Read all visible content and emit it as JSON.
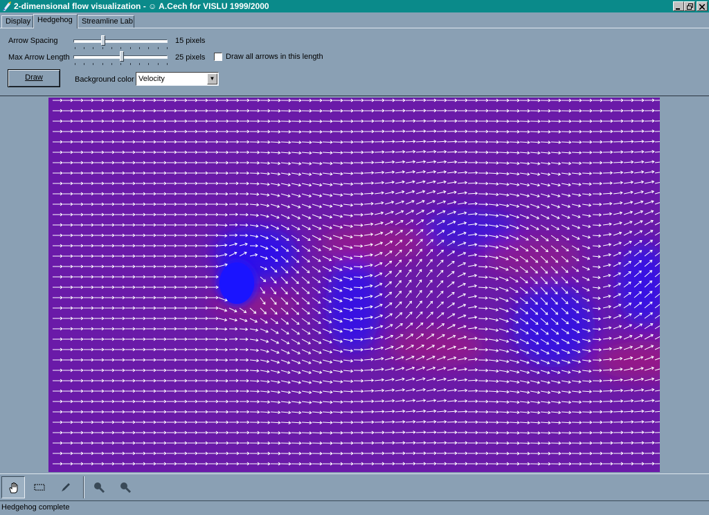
{
  "window": {
    "title": "2-dimensional flow visualization - ☺ A.Cech for VISLU 1999/2000",
    "controls": [
      "minimize",
      "restore",
      "close"
    ]
  },
  "tabs": [
    {
      "label": "Display",
      "active": false
    },
    {
      "label": "Hedgehog",
      "active": true
    },
    {
      "label": "Streamline Lab",
      "active": false
    }
  ],
  "hedgehog": {
    "arrow_spacing_label": "Arrow Spacing",
    "arrow_spacing_value": 15,
    "arrow_spacing_text": "15 pixels",
    "arrow_spacing_fraction": 0.4,
    "max_length_label": "Max Arrow Length",
    "max_length_value": 25,
    "max_length_text": "25 pixels",
    "max_length_fraction": 0.65,
    "draw_all_label": "Draw all arrows in this length",
    "draw_all_checked": false,
    "draw_button": "Draw",
    "bg_color_label": "Background color",
    "bg_color_value": "Velocity"
  },
  "visualization": {
    "base_color": "#6a1aa8",
    "low_velocity_color": "#2a10f0",
    "high_velocity_color": "#c0186a",
    "arrow_color": "#ffffff"
  },
  "toolbar": {
    "tools": [
      "hand-icon",
      "select-rect-icon",
      "pen-icon",
      "zoom-in-icon",
      "zoom-out-icon"
    ],
    "active_tool": "hand-icon"
  },
  "status": {
    "text": "Hedgehog complete"
  }
}
